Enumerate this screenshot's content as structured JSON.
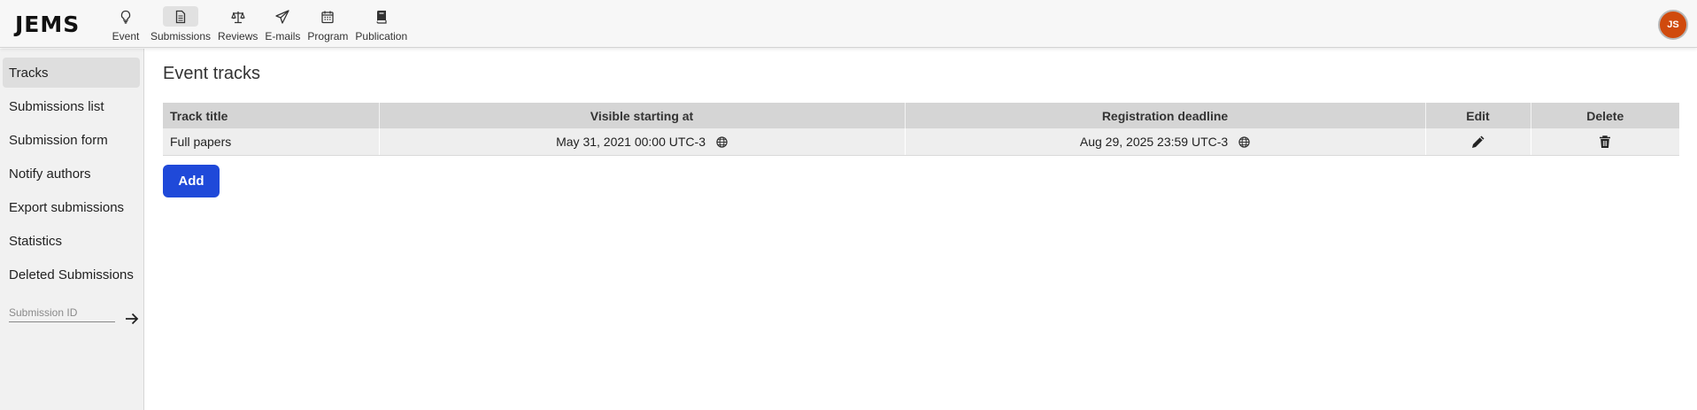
{
  "app": {
    "logo": "JEMS",
    "avatar_initials": "JS",
    "avatar_color": "#d04a0d"
  },
  "nav": [
    {
      "label": "Event",
      "icon": "lightbulb-icon",
      "active": false
    },
    {
      "label": "Submissions",
      "icon": "document-icon",
      "active": true
    },
    {
      "label": "Reviews",
      "icon": "scales-icon",
      "active": false
    },
    {
      "label": "E-mails",
      "icon": "paper-plane-icon",
      "active": false
    },
    {
      "label": "Program",
      "icon": "calendar-icon",
      "active": false
    },
    {
      "label": "Publication",
      "icon": "book-icon",
      "active": false
    }
  ],
  "sidebar": {
    "items": [
      {
        "label": "Tracks",
        "active": true
      },
      {
        "label": "Submissions list",
        "active": false
      },
      {
        "label": "Submission form",
        "active": false
      },
      {
        "label": "Notify authors",
        "active": false
      },
      {
        "label": "Export submissions",
        "active": false
      },
      {
        "label": "Statistics",
        "active": false
      },
      {
        "label": "Deleted Submissions",
        "active": false
      }
    ],
    "submission_id_placeholder": "Submission ID",
    "submission_id_value": ""
  },
  "main": {
    "title": "Event tracks",
    "table": {
      "headers": [
        "Track title",
        "Visible starting at",
        "Registration deadline",
        "Edit",
        "Delete"
      ],
      "rows": [
        {
          "title": "Full papers",
          "visible_from": "May 31, 2021 00:00 UTC-3",
          "deadline": "Aug 29, 2025 23:59 UTC-3"
        }
      ]
    },
    "add_label": "Add",
    "accent_color": "#1f49d9"
  }
}
